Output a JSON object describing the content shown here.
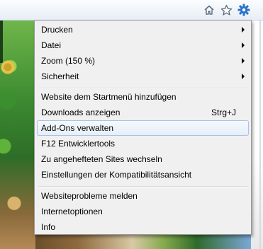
{
  "toolbar": {
    "icons": [
      "home-icon",
      "favorites-star-icon",
      "tools-gear-icon"
    ],
    "gear_color": "#2a73c8"
  },
  "menu": {
    "group1": [
      {
        "label": "Drucken",
        "submenu": true
      },
      {
        "label": "Datei",
        "submenu": true
      },
      {
        "label": "Zoom (150 %)",
        "submenu": true
      },
      {
        "label": "Sicherheit",
        "submenu": true
      }
    ],
    "group2": [
      {
        "label": "Website dem Startmenü hinzufügen"
      },
      {
        "label": "Downloads anzeigen",
        "shortcut": "Strg+J"
      },
      {
        "label": "Add-Ons verwalten",
        "highlighted": true
      },
      {
        "label": "F12 Entwicklertools"
      },
      {
        "label": "Zu angehefteten Sites wechseln"
      },
      {
        "label": "Einstellungen der Kompatibilitätsansicht"
      }
    ],
    "group3": [
      {
        "label": "Websiteprobleme melden"
      },
      {
        "label": "Internetoptionen"
      },
      {
        "label": "Info"
      }
    ]
  },
  "colors": {
    "menu_bg": "#f0f0f0",
    "highlight_border": "#a8c3e3"
  }
}
